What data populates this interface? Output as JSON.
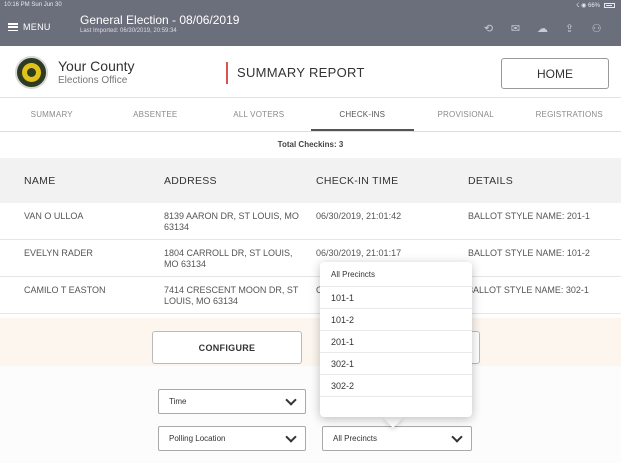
{
  "status": {
    "time": "10:16 PM  Sun Jun 30",
    "signal": "☇ ◉ 66%"
  },
  "menu": {
    "label": "MENU"
  },
  "election": {
    "title": "General Election - 08/06/2019",
    "last_imported": "Last Imported: 06/30/2019, 20:59:34"
  },
  "top_icons": [
    "history-icon",
    "mail-icon",
    "cloud-icon",
    "share-icon",
    "users-icon"
  ],
  "header": {
    "county_name": "Your County",
    "county_office": "Elections Office",
    "report_title": "SUMMARY REPORT",
    "home_label": "HOME"
  },
  "tabs": [
    {
      "label": "SUMMARY"
    },
    {
      "label": "ABSENTEE"
    },
    {
      "label": "ALL VOTERS"
    },
    {
      "label": "CHECK-INS",
      "active": true
    },
    {
      "label": "PROVISIONAL"
    },
    {
      "label": "REGISTRATIONS"
    }
  ],
  "table": {
    "total": "Total Checkins: 3",
    "headers": {
      "name": "NAME",
      "address": "ADDRESS",
      "time": "CHECK-IN TIME",
      "details": "DETAILS"
    },
    "rows": [
      {
        "name": "VAN O ULLOA",
        "address": "8139 AARON DR, ST LOUIS, MO 63134",
        "time": "06/30/2019, 21:01:42",
        "details": "BALLOT STYLE NAME: 201-1"
      },
      {
        "name": "EVELYN RADER",
        "address": "1804 CARROLL DR, ST LOUIS, MO 63134",
        "time": "06/30/2019, 21:01:17",
        "details": "BALLOT STYLE NAME: 101-2"
      },
      {
        "name": "CAMILO T EASTON",
        "address": "7414 CRESCENT MOON DR, ST LOUIS, MO 63134",
        "time": "C",
        "details": "3ALLOT STYLE NAME: 302-1"
      }
    ]
  },
  "controls": {
    "configure_label": "CONFIGURE",
    "sort_select": "Time",
    "group_select": "Polling Location",
    "precinct_select": "All Precincts"
  },
  "precinct_dropdown": {
    "options": [
      "All Precincts",
      "101-1",
      "101-2",
      "201-1",
      "302-1",
      "302-2"
    ]
  }
}
